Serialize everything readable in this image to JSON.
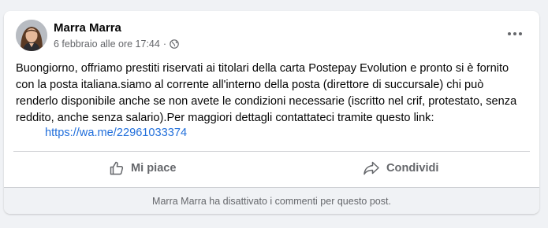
{
  "post": {
    "author": "Marra Marra",
    "date": "6 febbraio alle ore 17:44",
    "separator": "·",
    "privacy_icon": "globe-icon",
    "more_icon": "more-horizontal-icon",
    "body": "Buongiorno, offriamo prestiti riservati ai titolari della carta Postepay Evolution e pronto si è fornito con la posta italiana.siamo al corrente all'interno della posta (direttore di succursale) chi può renderlo disponibile anche se non avete le condizioni necessarie (iscritto nel crif, protestato, senza reddito, anche senza salario).Per maggiori dettagli contattateci tramite questo link:",
    "link": "https://wa.me/22961033374"
  },
  "actions": {
    "like_label": "Mi piace",
    "like_icon": "thumbs-up-icon",
    "share_label": "Condividi",
    "share_icon": "share-arrow-icon"
  },
  "footer": {
    "notice": "Marra Marra ha disattivato i commenti per questo post."
  },
  "colors": {
    "background": "#f0f2f5",
    "card": "#ffffff",
    "link": "#216fdb",
    "secondary_text": "#65676b"
  }
}
